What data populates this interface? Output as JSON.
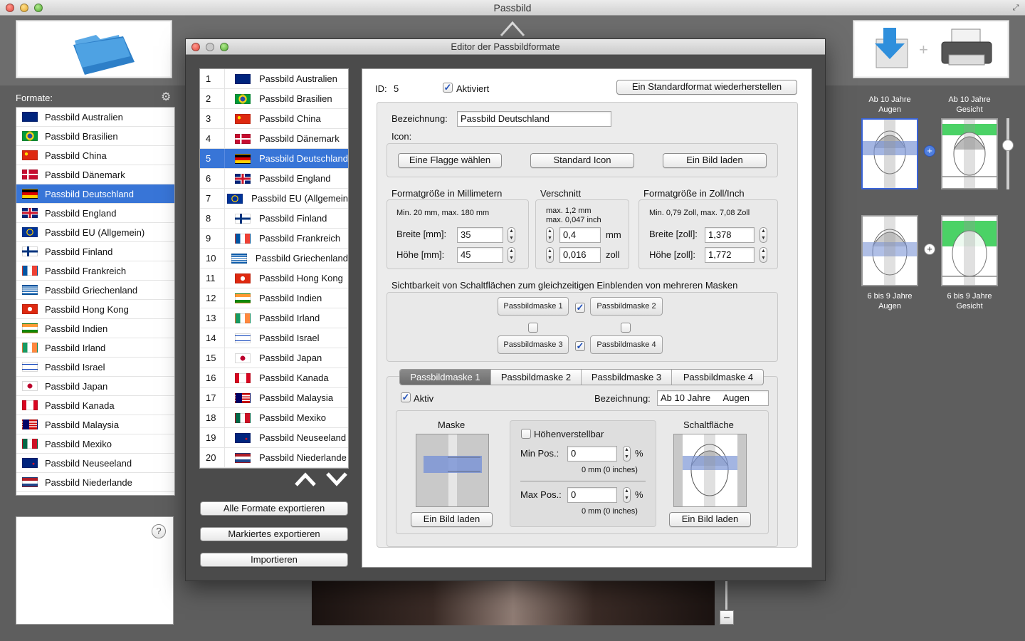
{
  "window": {
    "title": "Passbild"
  },
  "sidebar": {
    "formats_label": "Formate:",
    "items": [
      {
        "label": "Passbild Australien",
        "flag": "au"
      },
      {
        "label": "Passbild Brasilien",
        "flag": "br"
      },
      {
        "label": "Passbild China",
        "flag": "cn"
      },
      {
        "label": "Passbild Dänemark",
        "flag": "dk"
      },
      {
        "label": "Passbild Deutschland",
        "flag": "de",
        "selected": true
      },
      {
        "label": "Passbild England",
        "flag": "gb"
      },
      {
        "label": "Passbild EU (Allgemein)",
        "flag": "eu"
      },
      {
        "label": "Passbild Finland",
        "flag": "fi"
      },
      {
        "label": "Passbild Frankreich",
        "flag": "fr"
      },
      {
        "label": "Passbild Griechenland",
        "flag": "gr"
      },
      {
        "label": "Passbild Hong Kong",
        "flag": "hk"
      },
      {
        "label": "Passbild Indien",
        "flag": "in"
      },
      {
        "label": "Passbild Irland",
        "flag": "ie"
      },
      {
        "label": "Passbild Israel",
        "flag": "il"
      },
      {
        "label": "Passbild Japan",
        "flag": "jp"
      },
      {
        "label": "Passbild Kanada",
        "flag": "ca"
      },
      {
        "label": "Passbild Malaysia",
        "flag": "my"
      },
      {
        "label": "Passbild Mexiko",
        "flag": "mx"
      },
      {
        "label": "Passbild Neuseeland",
        "flag": "nz"
      },
      {
        "label": "Passbild Niederlande",
        "flag": "nl"
      }
    ],
    "help": "?"
  },
  "right_panel": {
    "top_left_label_1": "Ab 10 Jahre",
    "top_left_label_2": "Augen",
    "top_right_label_1": "Ab 10 Jahre",
    "top_right_label_2": "Gesicht",
    "bottom_left_label_1": "6 bis 9 Jahre",
    "bottom_left_label_2": "Augen",
    "bottom_right_label_1": "6 bis 9 Jahre",
    "bottom_right_label_2": "Gesicht",
    "plus": "+"
  },
  "editor": {
    "title": "Editor der Passbildformate",
    "list": [
      {
        "num": "1",
        "label": "Passbild Australien",
        "flag": "au"
      },
      {
        "num": "2",
        "label": "Passbild Brasilien",
        "flag": "br"
      },
      {
        "num": "3",
        "label": "Passbild China",
        "flag": "cn"
      },
      {
        "num": "4",
        "label": "Passbild Dänemark",
        "flag": "dk"
      },
      {
        "num": "5",
        "label": "Passbild Deutschland",
        "flag": "de",
        "selected": true
      },
      {
        "num": "6",
        "label": "Passbild England",
        "flag": "gb"
      },
      {
        "num": "7",
        "label": "Passbild EU (Allgemein",
        "flag": "eu"
      },
      {
        "num": "8",
        "label": "Passbild Finland",
        "flag": "fi"
      },
      {
        "num": "9",
        "label": "Passbild Frankreich",
        "flag": "fr"
      },
      {
        "num": "10",
        "label": "Passbild Griechenland",
        "flag": "gr"
      },
      {
        "num": "11",
        "label": "Passbild Hong Kong",
        "flag": "hk"
      },
      {
        "num": "12",
        "label": "Passbild Indien",
        "flag": "in"
      },
      {
        "num": "13",
        "label": "Passbild Irland",
        "flag": "ie"
      },
      {
        "num": "14",
        "label": "Passbild Israel",
        "flag": "il"
      },
      {
        "num": "15",
        "label": "Passbild Japan",
        "flag": "jp"
      },
      {
        "num": "16",
        "label": "Passbild Kanada",
        "flag": "ca"
      },
      {
        "num": "17",
        "label": "Passbild Malaysia",
        "flag": "my"
      },
      {
        "num": "18",
        "label": "Passbild Mexiko",
        "flag": "mx"
      },
      {
        "num": "19",
        "label": "Passbild Neuseeland",
        "flag": "nz"
      },
      {
        "num": "20",
        "label": "Passbild Niederlande",
        "flag": "nl"
      }
    ],
    "export_all": "Alle Formate exportieren",
    "export_selected": "Markiertes exportieren",
    "import": "Importieren",
    "detail": {
      "id_label": "ID:",
      "id_value": "5",
      "activated_label": "Aktiviert",
      "activated": true,
      "restore_button": "Ein Standardformat wiederherstellen",
      "name_label": "Bezeichnung:",
      "name_value": "Passbild Deutschland",
      "icon_label": "Icon:",
      "choose_flag": "Eine Flagge wählen",
      "standard_icon": "Standard Icon",
      "load_image": "Ein Bild laden",
      "mm_title": "Formatgröße in Millimetern",
      "mm_range": "Min. 20 mm, max. 180 mm",
      "width_mm_label": "Breite [mm]:",
      "width_mm": "35",
      "height_mm_label": "Höhe [mm]:",
      "height_mm": "45",
      "cut_title": "Verschnitt",
      "cut_range_1": "max. 1,2 mm",
      "cut_range_2": "max. 0,047 inch",
      "cut_mm": "0,4",
      "cut_mm_unit": "mm",
      "cut_inch": "0,016",
      "cut_inch_unit": "zoll",
      "inch_title": "Formatgröße in Zoll/Inch",
      "inch_range": "Min. 0,79 Zoll, max. 7,08 Zoll",
      "width_in_label": "Breite [zoll]:",
      "width_in": "1,378",
      "height_in_label": "Höhe [zoll]:",
      "height_in": "1,772",
      "visibility_title": "Sichtbarkeit von Schaltflächen zum gleichzeitigen Einblenden von mehreren Masken",
      "mask_buttons": [
        "Passbildmaske 1",
        "Passbildmaske 2",
        "Passbildmaske 3",
        "Passbildmaske 4"
      ],
      "tabs": [
        "Passbildmaske 1",
        "Passbildmaske 2",
        "Passbildmaske 3",
        "Passbildmaske 4"
      ],
      "active_label": "Aktiv",
      "mask_name_label": "Bezeichnung:",
      "mask_name_value": "Ab 10 Jahre     Augen",
      "mask_title": "Maske",
      "height_adj_label": "Höhenverstellbar",
      "min_pos_label": "Min Pos.:",
      "min_pos": "0",
      "min_pos_unit": "%",
      "min_pos_info": "0 mm (0 inches)",
      "max_pos_label": "Max Pos.:",
      "max_pos": "0",
      "max_pos_unit": "%",
      "max_pos_info": "0 mm (0 inches)",
      "button_title": "Schaltfläche",
      "mask_load": "Ein Bild laden",
      "button_load": "Ein Bild laden"
    }
  },
  "colors": {
    "selection": "#3875d7",
    "mask_band": "#7c95d6",
    "green_band": "#4bd266"
  }
}
